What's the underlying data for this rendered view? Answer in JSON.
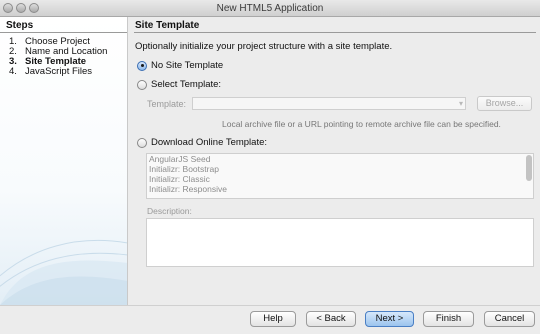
{
  "window": {
    "title": "New HTML5 Application"
  },
  "steps": {
    "header": "Steps",
    "items": [
      {
        "num": "1.",
        "label": "Choose Project"
      },
      {
        "num": "2.",
        "label": "Name and Location"
      },
      {
        "num": "3.",
        "label": "Site Template"
      },
      {
        "num": "4.",
        "label": "JavaScript Files"
      }
    ],
    "current": "Site Template"
  },
  "panel": {
    "header": "Site Template",
    "intro": "Optionally initialize your project structure with a site template.",
    "options": {
      "no_template": "No Site Template",
      "select_template": "Select Template:",
      "download_online": "Download Online Template:"
    },
    "selected_option": "No Site Template",
    "template_field": {
      "label": "Template:",
      "value": ""
    },
    "browse_label": "Browse...",
    "hint": "Local archive file or a URL pointing to remote archive file can be specified.",
    "online_templates": [
      "AngularJS Seed",
      "Initializr: Bootstrap",
      "Initializr: Classic",
      "Initializr: Responsive"
    ],
    "description_label": "Description:",
    "description_value": ""
  },
  "footer": {
    "help": "Help",
    "back": "< Back",
    "next": "Next >",
    "finish": "Finish",
    "cancel": "Cancel"
  },
  "colors": {
    "accent": "#3c6fb3",
    "default_button": "#9cc4ee"
  }
}
